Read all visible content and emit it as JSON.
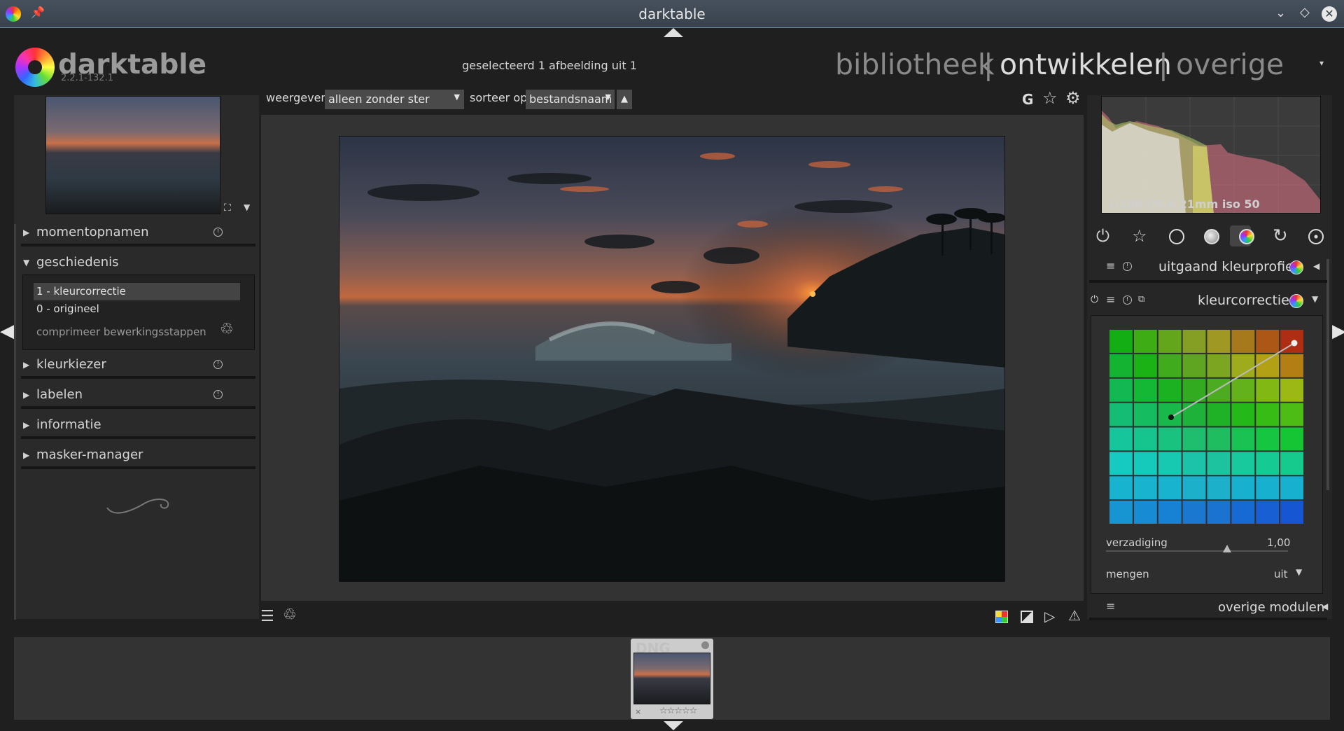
{
  "window": {
    "title": "darktable"
  },
  "logo": {
    "name": "darktable",
    "version": "2.2.1-132.1"
  },
  "header": {
    "status": "geselecteerd 1 afbeelding uit 1",
    "views": [
      "bibliotheek",
      "|",
      "ontwikkelen",
      "|",
      "overige"
    ],
    "active_view": "ontwikkelen"
  },
  "left_panel": {
    "modules": [
      {
        "label": "momentopnamen",
        "expanded": false
      },
      {
        "label": "geschiedenis",
        "expanded": true
      },
      {
        "label": "kleurkiezer",
        "expanded": false
      },
      {
        "label": "labelen",
        "expanded": false
      },
      {
        "label": "informatie",
        "expanded": false
      },
      {
        "label": "masker-manager",
        "expanded": false
      }
    ],
    "history": {
      "items": [
        "1 - kleurcorrectie",
        "0 - origineel"
      ],
      "selected_index": 0,
      "compress_label": "comprimeer bewerkingsstappen"
    }
  },
  "top_toolbar": {
    "show_label": "weergeven",
    "show_value": "alleen zonder ster",
    "sort_label": "sorteer op",
    "sort_value": "bestandsnaam",
    "g_label": "G"
  },
  "right_panel": {
    "histogram_info": "1/100 f/5,6 21mm iso 50",
    "group_icons": [
      "power-icon",
      "star-icon",
      "circle-icon",
      "gray-circle-icon",
      "color-wheel-icon",
      "rotate-icon",
      "film-reel-icon"
    ],
    "active_group": 4,
    "modules": {
      "output_profile": "uitgaand kleurprofiel",
      "color_correction": "kleurcorrectie",
      "saturation_label": "verzadiging",
      "saturation_value": "1,00",
      "blend_label": "mengen",
      "blend_value": "uit",
      "more_modules": "overige modulen"
    }
  },
  "filmstrip": {
    "rating_stars": "☆☆☆☆☆",
    "rating_reject": "×"
  },
  "colors": {
    "accent_blue": "#5b8ac0",
    "panel_bg": "#2a2a2a",
    "center_bg": "#333333"
  }
}
